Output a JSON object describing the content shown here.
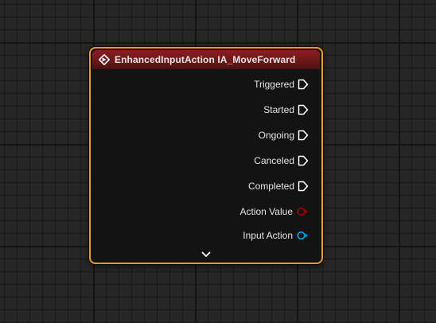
{
  "node": {
    "title": "EnhancedInputAction IA_MoveForward",
    "header_color": "#7a1a1a",
    "border_color": "#f39c12",
    "header_icon": "event-diamond-icon",
    "exec_pins": [
      {
        "label": "Triggered",
        "icon": "exec-pin-icon"
      },
      {
        "label": "Started",
        "icon": "exec-pin-icon"
      },
      {
        "label": "Ongoing",
        "icon": "exec-pin-icon"
      },
      {
        "label": "Canceled",
        "icon": "exec-pin-icon"
      },
      {
        "label": "Completed",
        "icon": "exec-pin-icon"
      }
    ],
    "data_pins": [
      {
        "label": "Action Value",
        "icon": "bool-pin-icon",
        "color": "#a30000"
      },
      {
        "label": "Input Action",
        "icon": "object-pin-icon",
        "color": "#00a8f3"
      }
    ],
    "expand_icon": "chevron-down-icon"
  }
}
